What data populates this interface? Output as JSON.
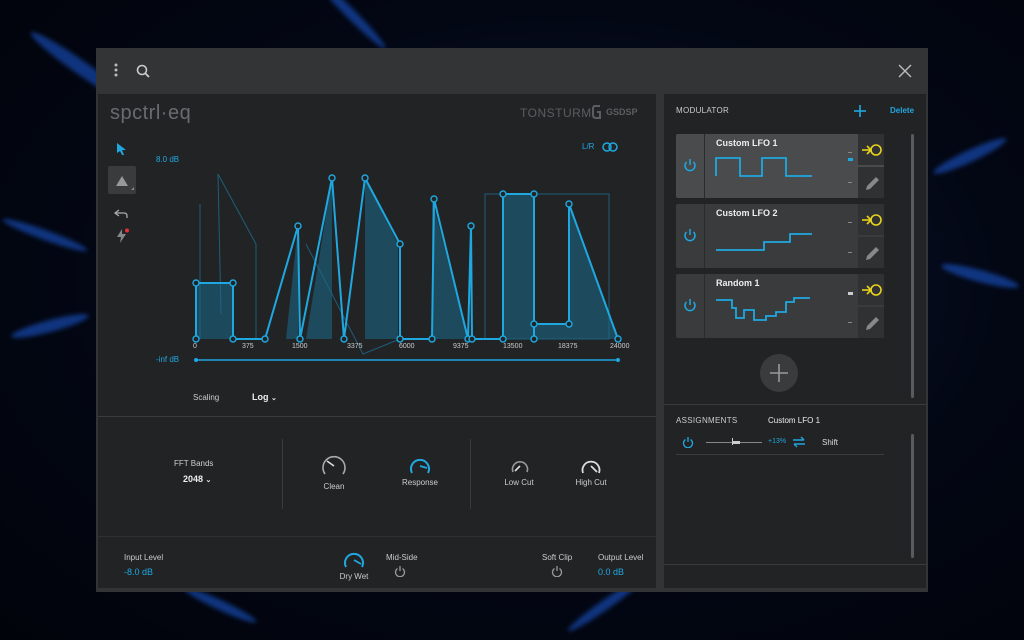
{
  "app": {
    "logo": "spctrl·eq",
    "brand": "TONSTURM",
    "brand2": "GSDSP"
  },
  "graph": {
    "max_label": "8.0 dB",
    "min_label": "-inf dB",
    "lr_label": "L/R",
    "x_ticks": [
      "0",
      "375",
      "1500",
      "3375",
      "6000",
      "9375",
      "13500",
      "18375",
      "24000"
    ]
  },
  "scaling": {
    "label": "Scaling",
    "value": "Log"
  },
  "fft": {
    "label": "FFT Bands",
    "value": "2048"
  },
  "knobs": {
    "clean": "Clean",
    "response": "Response",
    "low_cut": "Low Cut",
    "high_cut": "High Cut",
    "dry_wet": "Dry Wet"
  },
  "footer": {
    "input_label": "Input Level",
    "input_value": "-8.0 dB",
    "mid_side": "Mid-Side",
    "soft_clip": "Soft Clip",
    "output_label": "Output Level",
    "output_value": "0.0 dB"
  },
  "modulator": {
    "title": "MODULATOR",
    "delete": "Delete",
    "items": [
      {
        "name": "Custom LFO 1"
      },
      {
        "name": "Custom LFO 2"
      },
      {
        "name": "Random 1"
      }
    ]
  },
  "assignments": {
    "title": "ASSIGNMENTS",
    "selected": "Custom LFO 1",
    "row": {
      "amount": "+13%",
      "target": "Shift"
    }
  },
  "colors": {
    "accent": "#1fa8e0",
    "yellow": "#e8d21c",
    "panel": "#222325",
    "window": "#333436"
  },
  "icons": [
    "menu-dots-icon",
    "search-icon",
    "close-icon",
    "pointer-icon",
    "triangle-shape-icon",
    "undo-icon",
    "lightning-icon",
    "link-rings-icon",
    "power-icon",
    "assign-target-icon",
    "pencil-icon",
    "plus-icon",
    "swap-arrows-icon",
    "chevron-down-icon"
  ]
}
